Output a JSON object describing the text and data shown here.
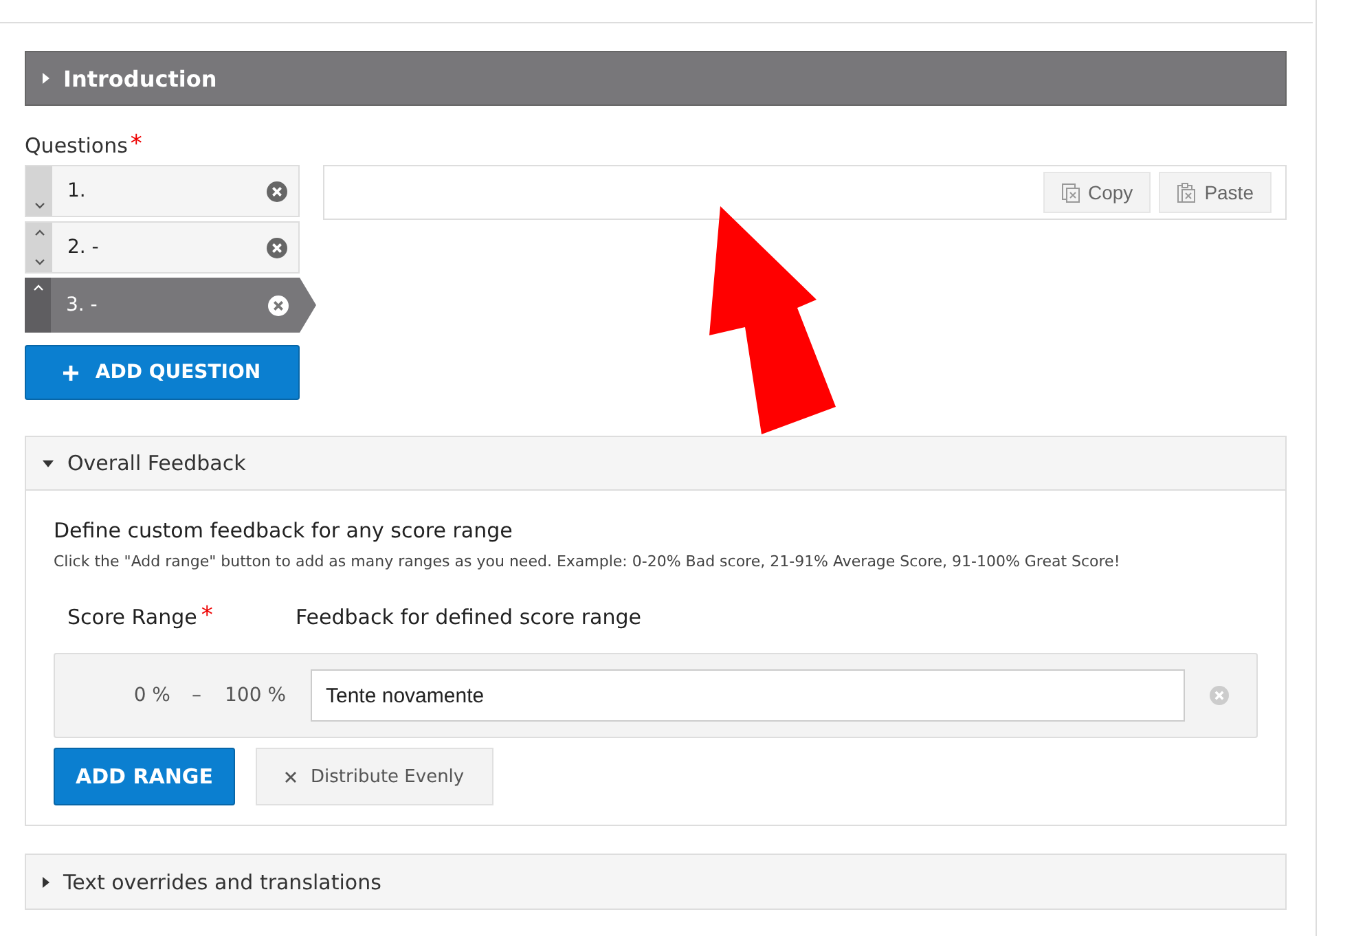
{
  "introduction": {
    "title": "Introduction",
    "expanded": false
  },
  "questions": {
    "label": "Questions",
    "required_mark": "*",
    "items": [
      {
        "label": "1.",
        "selected": false,
        "can_move_up": false,
        "can_move_down": true
      },
      {
        "label": "2. -",
        "selected": false,
        "can_move_up": true,
        "can_move_down": true
      },
      {
        "label": "3. -",
        "selected": true,
        "can_move_up": true,
        "can_move_down": false
      }
    ],
    "add_button": "ADD QUESTION",
    "copy_button": "Copy",
    "paste_button": "Paste"
  },
  "overall_feedback": {
    "title": "Overall Feedback",
    "expanded": true,
    "heading": "Define custom feedback for any score range",
    "description": "Click the \"Add range\" button to add as many ranges as you need. Example: 0-20% Bad score, 21-91% Average Score, 91-100% Great Score!",
    "score_range_label": "Score Range",
    "score_range_required_mark": "*",
    "feedback_label": "Feedback for defined score range",
    "ranges": [
      {
        "from": "0 %",
        "separator": "–",
        "to": "100 %",
        "feedback": "Tente novamente"
      }
    ],
    "add_range_button": "ADD RANGE",
    "distribute_button": "Distribute Evenly"
  },
  "text_overrides": {
    "title": "Text overrides and translations",
    "expanded": false
  }
}
